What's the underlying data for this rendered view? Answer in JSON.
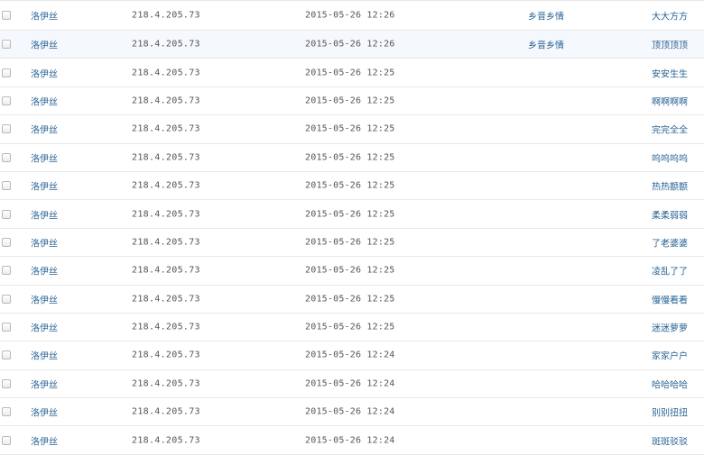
{
  "rows": [
    {
      "user": "洛伊丝",
      "ip": "218.4.205.73",
      "time": "2015-05-26 12:26",
      "location": "乡音乡情",
      "content": "大大方方",
      "highlight": false
    },
    {
      "user": "洛伊丝",
      "ip": "218.4.205.73",
      "time": "2015-05-26 12:26",
      "location": "乡音乡情",
      "content": "顶顶顶顶",
      "highlight": true
    },
    {
      "user": "洛伊丝",
      "ip": "218.4.205.73",
      "time": "2015-05-26 12:25",
      "location": "",
      "content": "安安生生",
      "highlight": false
    },
    {
      "user": "洛伊丝",
      "ip": "218.4.205.73",
      "time": "2015-05-26 12:25",
      "location": "",
      "content": "啊啊啊啊",
      "highlight": false
    },
    {
      "user": "洛伊丝",
      "ip": "218.4.205.73",
      "time": "2015-05-26 12:25",
      "location": "",
      "content": "完完全全",
      "highlight": false
    },
    {
      "user": "洛伊丝",
      "ip": "218.4.205.73",
      "time": "2015-05-26 12:25",
      "location": "",
      "content": "呜呜呜呜",
      "highlight": false
    },
    {
      "user": "洛伊丝",
      "ip": "218.4.205.73",
      "time": "2015-05-26 12:25",
      "location": "",
      "content": "热热额额",
      "highlight": false
    },
    {
      "user": "洛伊丝",
      "ip": "218.4.205.73",
      "time": "2015-05-26 12:25",
      "location": "",
      "content": "柔柔弱弱",
      "highlight": false
    },
    {
      "user": "洛伊丝",
      "ip": "218.4.205.73",
      "time": "2015-05-26 12:25",
      "location": "",
      "content": "了老婆婆",
      "highlight": false
    },
    {
      "user": "洛伊丝",
      "ip": "218.4.205.73",
      "time": "2015-05-26 12:25",
      "location": "",
      "content": "凌乱了了",
      "highlight": false
    },
    {
      "user": "洛伊丝",
      "ip": "218.4.205.73",
      "time": "2015-05-26 12:25",
      "location": "",
      "content": "慢慢看看",
      "highlight": false
    },
    {
      "user": "洛伊丝",
      "ip": "218.4.205.73",
      "time": "2015-05-26 12:25",
      "location": "",
      "content": "迷迷萝萝",
      "highlight": false
    },
    {
      "user": "洛伊丝",
      "ip": "218.4.205.73",
      "time": "2015-05-26 12:24",
      "location": "",
      "content": "家家户户",
      "highlight": false
    },
    {
      "user": "洛伊丝",
      "ip": "218.4.205.73",
      "time": "2015-05-26 12:24",
      "location": "",
      "content": "哈哈哈哈",
      "highlight": false
    },
    {
      "user": "洛伊丝",
      "ip": "218.4.205.73",
      "time": "2015-05-26 12:24",
      "location": "",
      "content": "别别扭扭",
      "highlight": false
    },
    {
      "user": "洛伊丝",
      "ip": "218.4.205.73",
      "time": "2015-05-26 12:24",
      "location": "",
      "content": "斑斑驳驳",
      "highlight": false
    }
  ]
}
